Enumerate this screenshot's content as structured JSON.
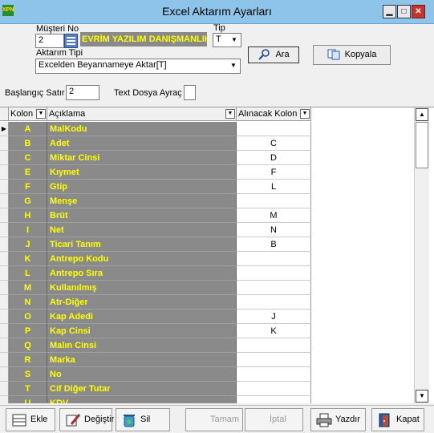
{
  "window": {
    "title": "Excel Aktarım Ayarları",
    "icon_text": "XPN",
    "min": "▁",
    "max": "□",
    "close": "✕"
  },
  "form": {
    "musteri_label": "Müşteri No",
    "musteri_value": "2",
    "company_name": "EVRİM YAZILIM DANIŞMANLIK",
    "tip_label": "Tip",
    "tip_value": "T",
    "aktarim_label": "Aktarım Tipi",
    "aktarim_value": "Excelden Beyannameye Aktar[T]",
    "ara_label": "Ara",
    "kopyala_label": "Kopyala",
    "baslangic_label": "Başlangıç Satır",
    "baslangic_value": "2",
    "ayrac_label": "Text Dosya Ayraç",
    "ayrac_value": ""
  },
  "grid": {
    "headers": [
      "Kolon",
      "Açıklama",
      "Alınacak Kolon"
    ],
    "rows": [
      {
        "k": "A",
        "d": "MalKodu",
        "a": ""
      },
      {
        "k": "B",
        "d": "Adet",
        "a": "C"
      },
      {
        "k": "C",
        "d": "Miktar Cinsi",
        "a": "D"
      },
      {
        "k": "E",
        "d": "Kıymet",
        "a": "F"
      },
      {
        "k": "F",
        "d": "Gtip",
        "a": "L"
      },
      {
        "k": "G",
        "d": "Menşe",
        "a": ""
      },
      {
        "k": "H",
        "d": "Brüt",
        "a": "M"
      },
      {
        "k": "I",
        "d": "Net",
        "a": "N"
      },
      {
        "k": "J",
        "d": "Ticari Tanım",
        "a": "B"
      },
      {
        "k": "K",
        "d": "Antrepo Kodu",
        "a": ""
      },
      {
        "k": "L",
        "d": "Antrepo Sıra",
        "a": ""
      },
      {
        "k": "M",
        "d": "Kullanılmış",
        "a": ""
      },
      {
        "k": "N",
        "d": "Atr-Diğer",
        "a": ""
      },
      {
        "k": "O",
        "d": "Kap Adedi",
        "a": "J"
      },
      {
        "k": "P",
        "d": "Kap Cinsi",
        "a": "K"
      },
      {
        "k": "Q",
        "d": "Malın Cinsi",
        "a": ""
      },
      {
        "k": "R",
        "d": "Marka",
        "a": ""
      },
      {
        "k": "S",
        "d": "No",
        "a": ""
      },
      {
        "k": "T",
        "d": "Cif Diğer Tutar",
        "a": ""
      },
      {
        "k": "U",
        "d": "KDV",
        "a": ""
      }
    ]
  },
  "toolbar": {
    "ekle": "Ekle",
    "degistir": "Değiştir",
    "sil": "Sil",
    "tamam": "Tamam",
    "iptal": "İptal",
    "yazdir": "Yazdır",
    "kapat": "Kapat"
  },
  "colors": {
    "cell_bg": "#8a8a8a",
    "cell_text": "#ffff00",
    "titlebar": "#8ec4ea"
  }
}
